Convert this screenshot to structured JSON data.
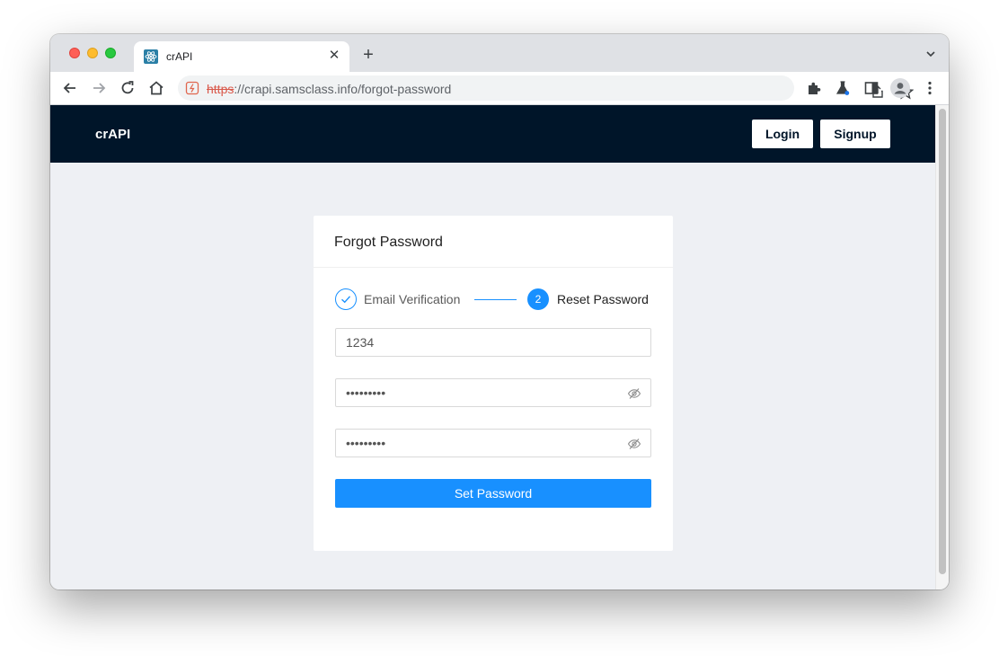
{
  "browser": {
    "tab_title": "crAPI",
    "url_scheme": "https",
    "url_rest": "://crapi.samsclass.info/forgot-password",
    "icons": [
      "back-icon",
      "forward-icon",
      "reload-icon",
      "home-icon",
      "not-secure-icon",
      "share-icon",
      "star-icon",
      "extensions-icon",
      "labs-icon",
      "side-panel-icon",
      "profile-icon",
      "menu-icon"
    ]
  },
  "header": {
    "brand": "crAPI",
    "login_label": "Login",
    "signup_label": "Signup",
    "background": "#001529"
  },
  "card": {
    "title": "Forgot Password",
    "steps": [
      {
        "label": "Email Verification",
        "status": "done"
      },
      {
        "number": "2",
        "label": "Reset Password",
        "status": "current"
      }
    ],
    "fields": {
      "otp_value": "1234",
      "password_value": "•••••••••",
      "confirm_value": "•••••••••"
    },
    "submit_label": "Set Password",
    "accent": "#1890ff"
  }
}
